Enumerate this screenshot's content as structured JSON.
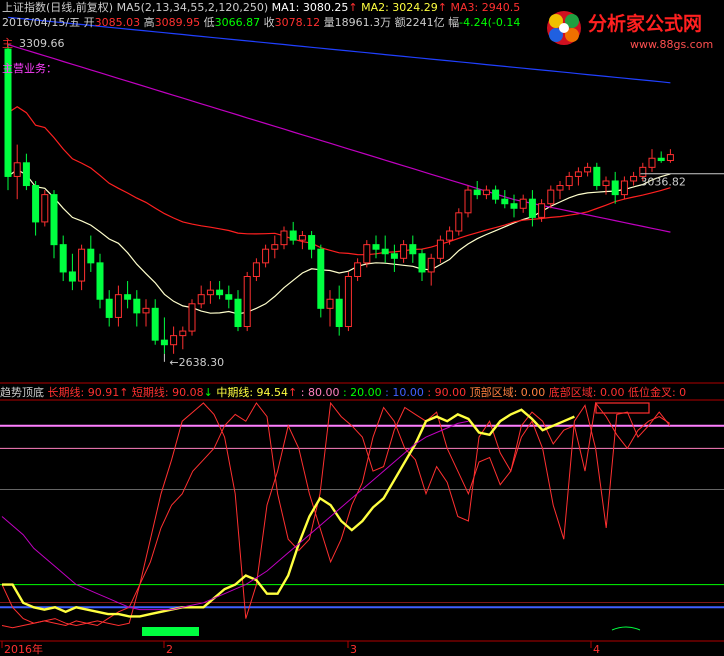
{
  "header": {
    "line1": [
      {
        "t": "上证指数(日线,前复权)",
        "c": "#cccccc"
      },
      {
        "t": " MA5(2,13,34,55,2,120,250)",
        "c": "#cccccc"
      },
      {
        "t": "  MA1: 3080.25",
        "c": "#ffffff"
      },
      {
        "t": "↑",
        "c": "#ff3030"
      },
      {
        "t": "  MA2: 3024.29",
        "c": "#ffff40"
      },
      {
        "t": "↑",
        "c": "#ff3030"
      },
      {
        "t": "  MA3: 2940.5",
        "c": "#ff3030"
      }
    ],
    "line2": [
      {
        "t": "2016/04/15/五",
        "c": "#cccccc"
      },
      {
        "t": " 开",
        "c": "#cccccc"
      },
      {
        "t": "3085.03",
        "c": "#ff3030"
      },
      {
        "t": " 高",
        "c": "#cccccc"
      },
      {
        "t": "3089.95",
        "c": "#ff3030"
      },
      {
        "t": " 低",
        "c": "#cccccc"
      },
      {
        "t": "3066.87",
        "c": "#00ff00"
      },
      {
        "t": " 收",
        "c": "#cccccc"
      },
      {
        "t": "3078.12",
        "c": "#ff3030"
      },
      {
        "t": " 量",
        "c": "#cccccc"
      },
      {
        "t": "18961.3万",
        "c": "#cccccc"
      },
      {
        "t": " 额",
        "c": "#cccccc"
      },
      {
        "t": "2241亿",
        "c": "#cccccc"
      },
      {
        "t": " 幅",
        "c": "#cccccc"
      },
      {
        "t": "-4.24(-0.14",
        "c": "#00ff00"
      }
    ],
    "line3_prefix": "主",
    "line3_value": "3309.66",
    "line4": "主营业务："
  },
  "brand": {
    "name": "分析家公式网",
    "url": "www.88gs.com"
  },
  "indicator": {
    "items": [
      {
        "t": "趋势顶底",
        "c": "#cccccc"
      },
      {
        "t": "  长期线: ",
        "c": "#ff3030"
      },
      {
        "t": "90.91",
        "c": "#ff3030"
      },
      {
        "t": "↑",
        "c": "#ff3030"
      },
      {
        "t": "  短期线: ",
        "c": "#ff3030"
      },
      {
        "t": "90.08",
        "c": "#ff3030"
      },
      {
        "t": "↓",
        "c": "#00ff00"
      },
      {
        "t": "  中期线: ",
        "c": "#ffff40"
      },
      {
        "t": "94.54",
        "c": "#ffff40"
      },
      {
        "t": "↑",
        "c": "#ff3030"
      },
      {
        "t": "  : 80.00",
        "c": "#ff80c0"
      },
      {
        "t": "  : 20.00",
        "c": "#00ff00"
      },
      {
        "t": "  : 10.00",
        "c": "#4060ff"
      },
      {
        "t": "  : 90.00",
        "c": "#ff3030"
      },
      {
        "t": "  顶部区域: 0.00",
        "c": "#ff8040"
      },
      {
        "t": "  底部区域: 0.00",
        "c": "#ff3030"
      },
      {
        "t": "  低位金叉: 0",
        "c": "#ff3030"
      }
    ]
  },
  "chart_data": {
    "type": "candlestick",
    "price_labels": {
      "high": "3309.66",
      "low": "2638.30",
      "last": "3036.82"
    },
    "x_axis_labels": [
      "2016年",
      "2",
      "3",
      "4"
    ],
    "reference_lines": [
      80,
      20,
      10,
      90
    ],
    "candles": [
      [
        3310,
        3320,
        3000,
        3030
      ],
      [
        3030,
        3100,
        2980,
        3060
      ],
      [
        3060,
        3080,
        3000,
        3010
      ],
      [
        3010,
        3020,
        2900,
        2930
      ],
      [
        2930,
        3000,
        2920,
        2990
      ],
      [
        2990,
        3000,
        2850,
        2880
      ],
      [
        2880,
        2900,
        2800,
        2820
      ],
      [
        2820,
        2860,
        2780,
        2800
      ],
      [
        2800,
        2880,
        2780,
        2870
      ],
      [
        2870,
        2900,
        2820,
        2840
      ],
      [
        2840,
        2860,
        2740,
        2760
      ],
      [
        2760,
        2780,
        2700,
        2720
      ],
      [
        2720,
        2790,
        2700,
        2770
      ],
      [
        2770,
        2800,
        2740,
        2760
      ],
      [
        2760,
        2780,
        2700,
        2730
      ],
      [
        2730,
        2760,
        2700,
        2740
      ],
      [
        2740,
        2760,
        2660,
        2670
      ],
      [
        2670,
        2720,
        2640,
        2660
      ],
      [
        2660,
        2700,
        2640,
        2680
      ],
      [
        2680,
        2700,
        2650,
        2690
      ],
      [
        2690,
        2760,
        2680,
        2750
      ],
      [
        2750,
        2790,
        2740,
        2770
      ],
      [
        2770,
        2800,
        2750,
        2780
      ],
      [
        2780,
        2800,
        2760,
        2770
      ],
      [
        2770,
        2790,
        2740,
        2760
      ],
      [
        2760,
        2780,
        2690,
        2700
      ],
      [
        2700,
        2820,
        2690,
        2810
      ],
      [
        2810,
        2850,
        2800,
        2840
      ],
      [
        2840,
        2880,
        2830,
        2870
      ],
      [
        2870,
        2900,
        2850,
        2880
      ],
      [
        2880,
        2920,
        2870,
        2910
      ],
      [
        2910,
        2930,
        2880,
        2890
      ],
      [
        2890,
        2910,
        2870,
        2900
      ],
      [
        2900,
        2910,
        2850,
        2870
      ],
      [
        2870,
        2880,
        2720,
        2740
      ],
      [
        2740,
        2780,
        2700,
        2760
      ],
      [
        2760,
        2790,
        2680,
        2700
      ],
      [
        2700,
        2820,
        2690,
        2810
      ],
      [
        2810,
        2850,
        2800,
        2840
      ],
      [
        2840,
        2890,
        2830,
        2880
      ],
      [
        2880,
        2900,
        2850,
        2870
      ],
      [
        2870,
        2900,
        2840,
        2860
      ],
      [
        2860,
        2880,
        2820,
        2850
      ],
      [
        2850,
        2890,
        2840,
        2880
      ],
      [
        2880,
        2900,
        2840,
        2860
      ],
      [
        2860,
        2870,
        2800,
        2820
      ],
      [
        2820,
        2860,
        2790,
        2850
      ],
      [
        2850,
        2900,
        2840,
        2890
      ],
      [
        2890,
        2920,
        2880,
        2910
      ],
      [
        2910,
        2960,
        2900,
        2950
      ],
      [
        2950,
        3010,
        2940,
        3000
      ],
      [
        3000,
        3020,
        2980,
        2990
      ],
      [
        2990,
        3010,
        2980,
        3000
      ],
      [
        3000,
        3010,
        2970,
        2980
      ],
      [
        2980,
        3000,
        2960,
        2970
      ],
      [
        2970,
        2990,
        2940,
        2960
      ],
      [
        2960,
        2990,
        2950,
        2980
      ],
      [
        2980,
        3000,
        2920,
        2940
      ],
      [
        2940,
        2980,
        2930,
        2970
      ],
      [
        2970,
        3010,
        2960,
        3000
      ],
      [
        3000,
        3020,
        2980,
        3010
      ],
      [
        3010,
        3040,
        3000,
        3030
      ],
      [
        3030,
        3050,
        3010,
        3040
      ],
      [
        3040,
        3060,
        3030,
        3050
      ],
      [
        3050,
        3060,
        3000,
        3010
      ],
      [
        3010,
        3030,
        2990,
        3020
      ],
      [
        3020,
        3040,
        2970,
        2990
      ],
      [
        2990,
        3030,
        2980,
        3020
      ],
      [
        3020,
        3040,
        3010,
        3030
      ],
      [
        3030,
        3060,
        3020,
        3050
      ],
      [
        3050,
        3090,
        3040,
        3070
      ],
      [
        3070,
        3085,
        3060,
        3065
      ],
      [
        3065,
        3090,
        3060,
        3078
      ]
    ],
    "indicator_series": [
      {
        "name": "长期线",
        "color": "#ff3030",
        "values": [
          2,
          1,
          2,
          3,
          4,
          3,
          2,
          4,
          3,
          2,
          5,
          8,
          10,
          20,
          30,
          45,
          55,
          60,
          70,
          75,
          80,
          90,
          95,
          92,
          100,
          94,
          60,
          40,
          35,
          40,
          60,
          100,
          94,
          90,
          85,
          70,
          72,
          88,
          98,
          95,
          92,
          96,
          80,
          70,
          60,
          74,
          76,
          64,
          70,
          90,
          96,
          92,
          82,
          88,
          90,
          70,
          100,
          94,
          86,
          80,
          88,
          92,
          94,
          91
        ]
      },
      {
        "name": "短期线",
        "color": "#ff3030",
        "values": [
          20,
          10,
          5,
          3,
          4,
          5,
          3,
          2,
          3,
          4,
          3,
          2,
          3,
          20,
          40,
          60,
          75,
          92,
          96,
          100,
          95,
          85,
          60,
          5,
          20,
          55,
          70,
          90,
          80,
          60,
          45,
          30,
          40,
          55,
          65,
          85,
          98,
          92,
          80,
          75,
          60,
          72,
          65,
          50,
          48,
          85,
          92,
          78,
          70,
          85,
          92,
          80,
          55,
          40,
          92,
          99,
          80,
          45,
          95,
          96,
          85,
          90,
          96,
          90
        ]
      },
      {
        "name": "中期线",
        "color": "#ffff40",
        "values": [
          20,
          20,
          12,
          10,
          9,
          10,
          8,
          10,
          9,
          8,
          7,
          7,
          6,
          6,
          7,
          8,
          9,
          10,
          10,
          10,
          14,
          18,
          20,
          24,
          22,
          16,
          16,
          24,
          38,
          50,
          58,
          55,
          48,
          44,
          48,
          54,
          58,
          66,
          74,
          82,
          92,
          94,
          92,
          95,
          93,
          87,
          86,
          92,
          95,
          97,
          93,
          88,
          90,
          92,
          94
        ]
      },
      {
        "name": "趋势线",
        "color": "#c000c0",
        "values": [
          50,
          46,
          42,
          36,
          32,
          28,
          24,
          20,
          18,
          16,
          14,
          12,
          10,
          9,
          9,
          9,
          9,
          10,
          11,
          12,
          14,
          16,
          18,
          20,
          23,
          26,
          30,
          34,
          38,
          42,
          46,
          50,
          54,
          58,
          62,
          66,
          70,
          74,
          78,
          82,
          85,
          87,
          89,
          91,
          92
        ]
      }
    ]
  }
}
